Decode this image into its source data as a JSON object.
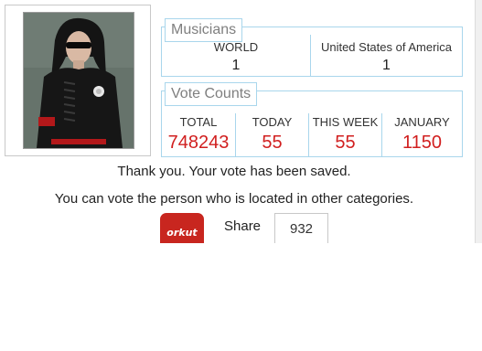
{
  "photo": {
    "description_icon": "person-photo"
  },
  "musicians": {
    "title": "Musicians",
    "columns": [
      {
        "label": "WORLD",
        "value": "1"
      },
      {
        "label": "United States of America",
        "value": "1"
      }
    ]
  },
  "votes": {
    "title": "Vote Counts",
    "columns": [
      {
        "label": "TOTAL",
        "value": "748243"
      },
      {
        "label": "TODAY",
        "value": "55"
      },
      {
        "label": "THIS WEEK",
        "value": "55"
      },
      {
        "label": "JANUARY",
        "value": "1150"
      }
    ]
  },
  "messages": {
    "saved": "Thank you. Your vote has been saved.",
    "other": "You can vote the person who is located in other categories."
  },
  "share": {
    "orkut_label": "orkut",
    "label": "Share",
    "count": "932"
  },
  "colors": {
    "accent_border": "#a9d6ec",
    "vote_value": "#d11f1f",
    "orkut_red": "#c8261f"
  }
}
